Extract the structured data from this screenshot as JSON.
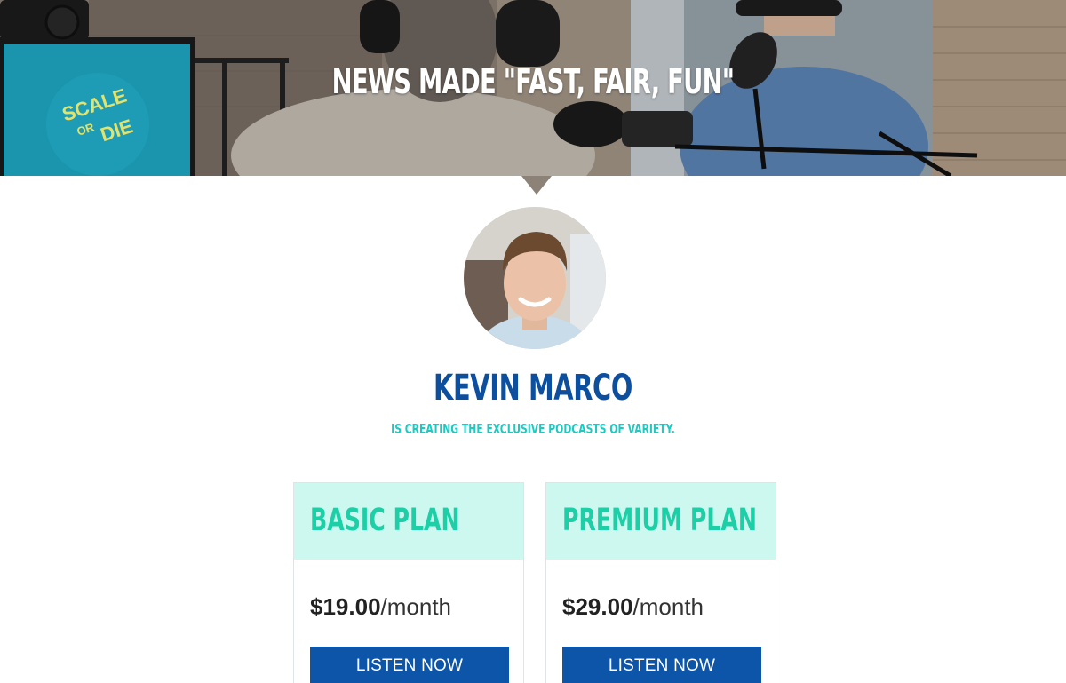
{
  "hero": {
    "title": "NEWS MADE \"FAST, FAIR, FUN\"",
    "monitor_text_1": "SCALE",
    "monitor_text_2": "OR",
    "monitor_text_3": "DIE",
    "colors": {
      "monitor": "#1fa9c7",
      "overlay": "#7f756b"
    }
  },
  "profile": {
    "name": "KEVIN MARCO",
    "tagline": "IS CREATING THE EXCLUSIVE PODCASTS OF VARIETY."
  },
  "plans": [
    {
      "name": "BASIC PLAN",
      "price": "$19.00",
      "period": "/month",
      "button": "LISTEN NOW"
    },
    {
      "name": "PREMIUM PLAN",
      "price": "$29.00",
      "period": "/month",
      "button": "LISTEN NOW"
    }
  ],
  "theme": {
    "primary": "#0d55a8",
    "name_color": "#0d4f9f",
    "accent": "#1ec9c0",
    "plan_header_bg": "#cdf8ef"
  }
}
